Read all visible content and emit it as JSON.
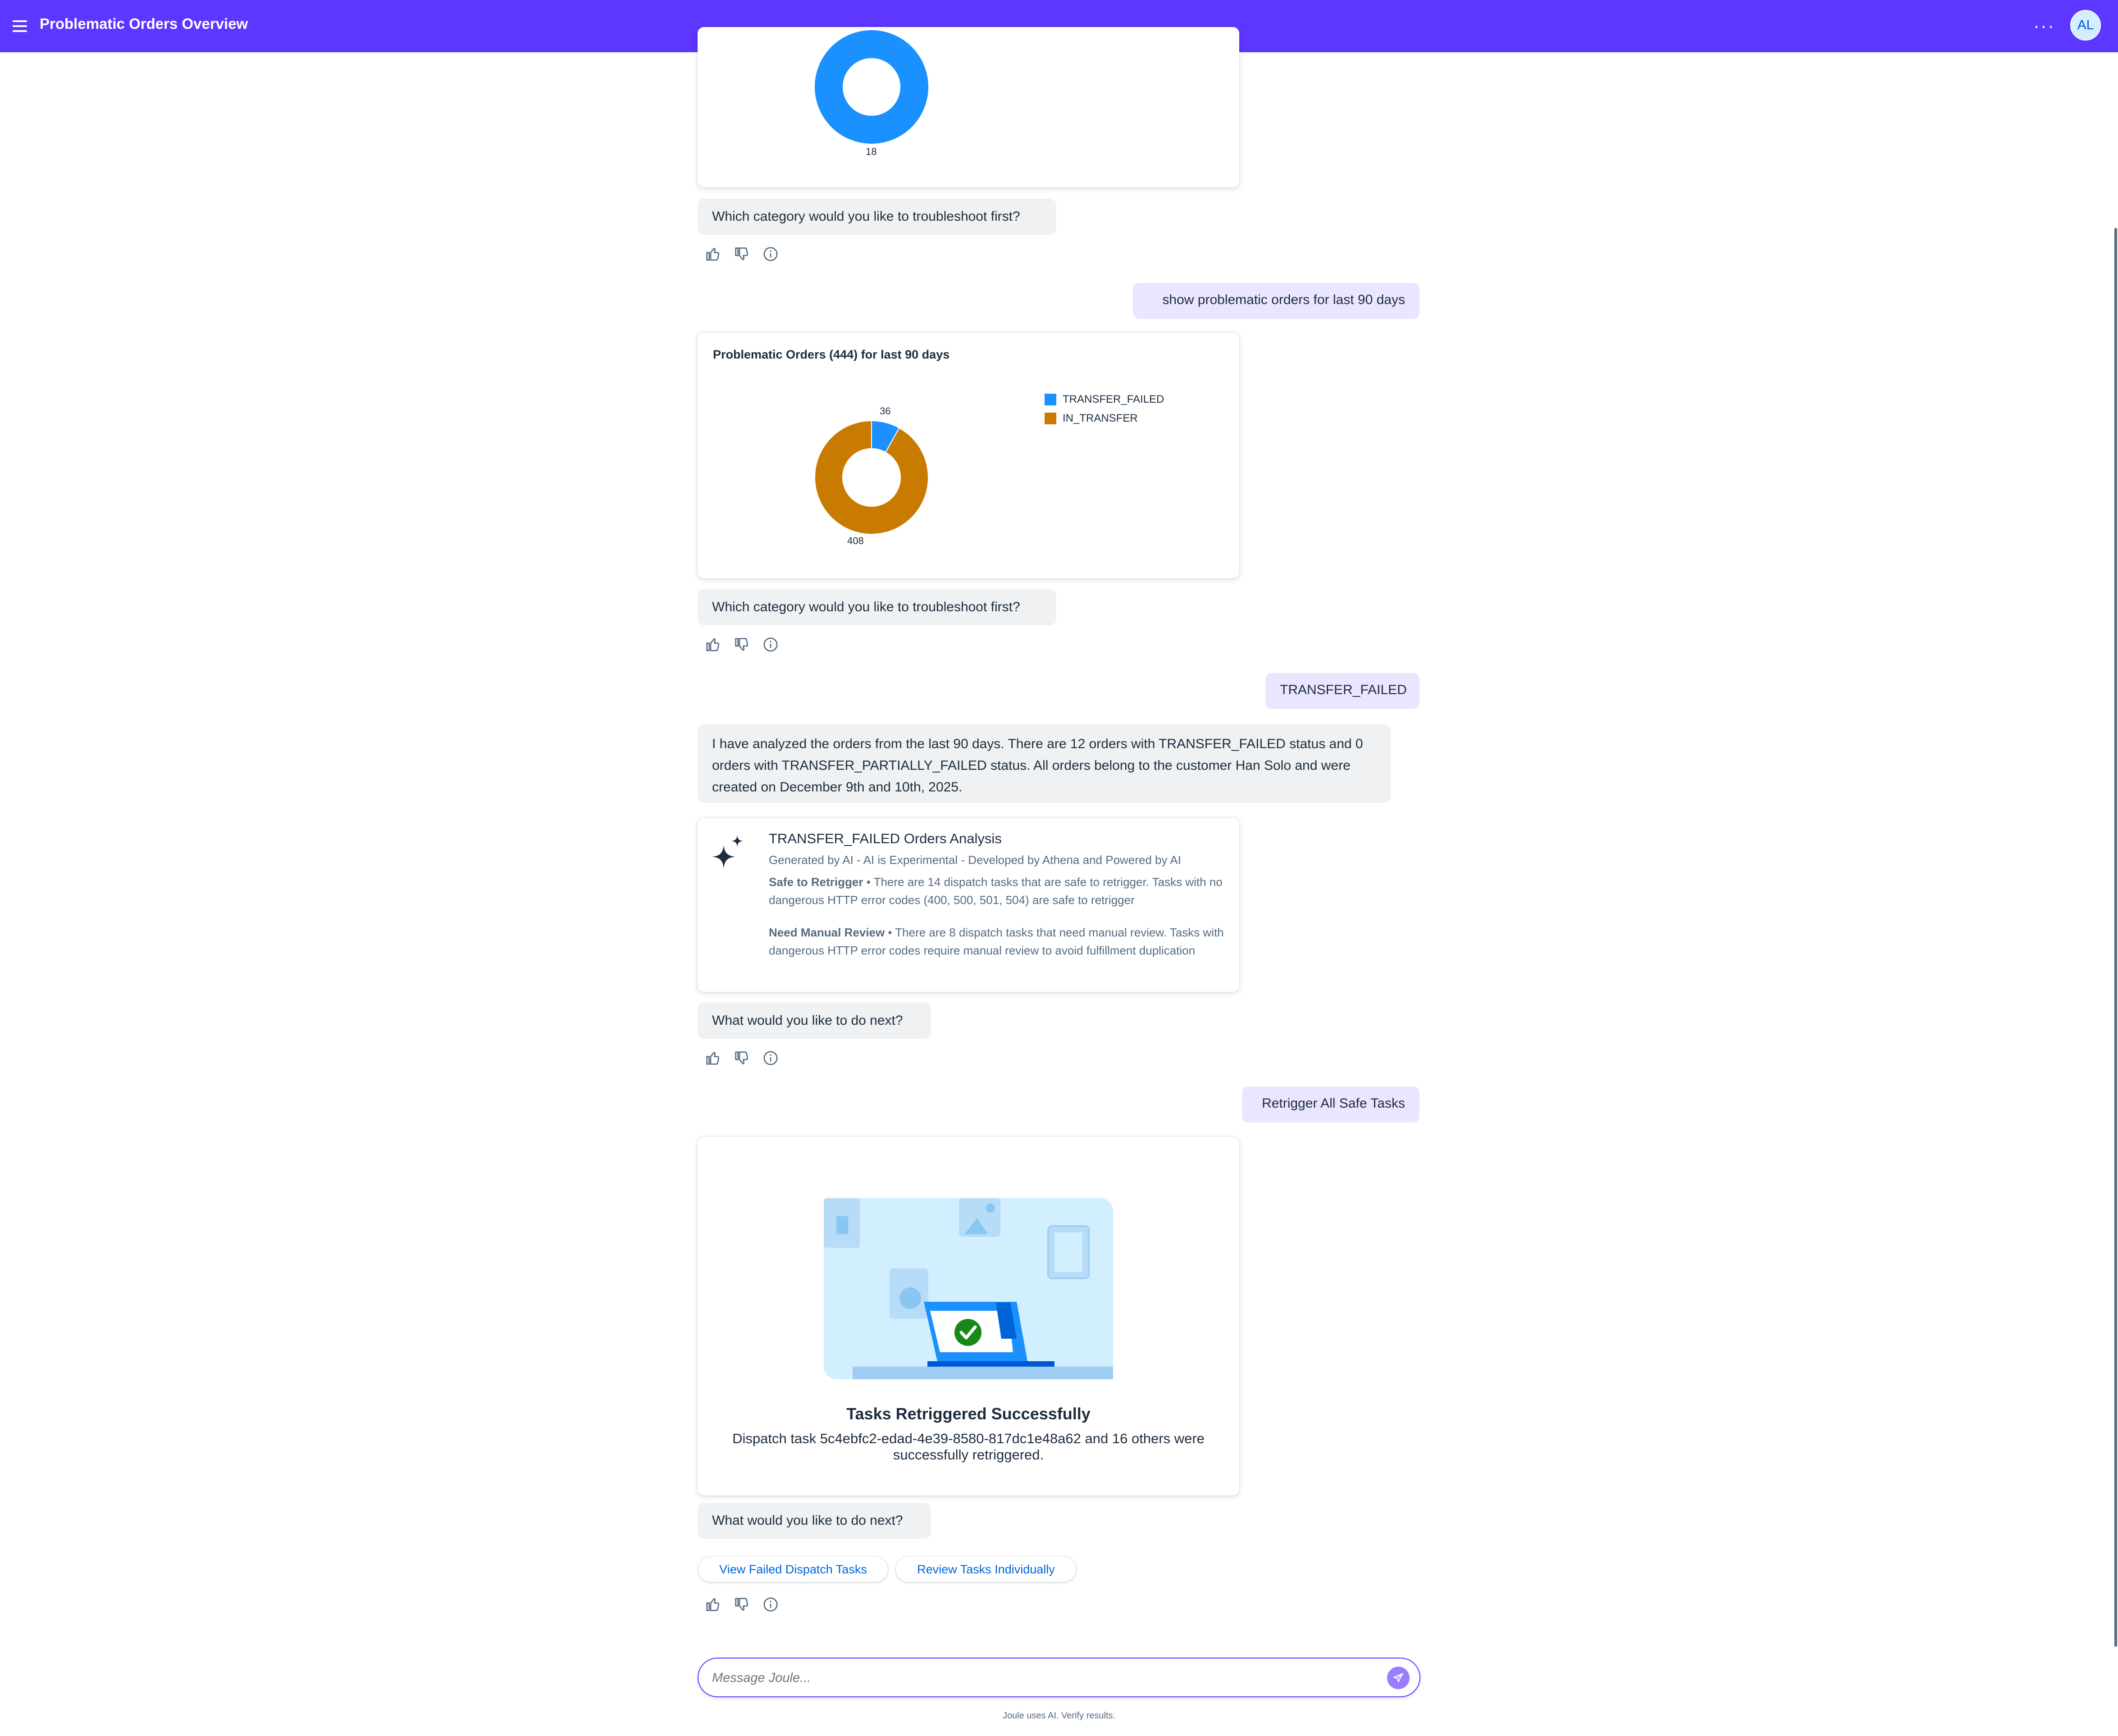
{
  "header": {
    "title": "Problematic Orders Overview",
    "more_icon": "more-horizontal-icon",
    "avatar_initials": "AL",
    "color": "#5d36ff"
  },
  "conversation": {
    "first_chart": {
      "bottom_label": "18",
      "color": "#1b90ff"
    },
    "msg1": "Which category would you like to troubleshoot first?",
    "user1": "show problematic orders for last 90 days",
    "chart2": {
      "title": "Problematic Orders (444) for last 90 days",
      "label_small": "36",
      "label_large": "408"
    },
    "msg2": "Which category would you like to troubleshoot first?",
    "user2": "TRANSFER_FAILED",
    "analysis_text": "I have analyzed the orders from the last 90 days. There are 12 orders with TRANSFER_FAILED status and 0 orders with TRANSFER_PARTIALLY_FAILED status. All orders belong to the customer Han Solo and were created on December 9th and 10th, 2025.",
    "analysis_card": {
      "title": "TRANSFER_FAILED Orders Analysis",
      "subtitle": "Generated by AI - AI is Experimental - Developed by Athena and Powered by AI",
      "safe_heading": "Safe to Retrigger",
      "safe_text": " • There are 14 dispatch tasks that are safe to retrigger. Tasks with no dangerous HTTP error codes (400, 500, 501, 504) are safe to retrigger",
      "review_heading": "Need Manual Review",
      "review_text": " • There are 8 dispatch tasks that need manual review. Tasks with dangerous HTTP error codes require manual review to avoid fulfillment duplication"
    },
    "msg3": "What would you like to do next?",
    "user3": "Retrigger All Safe Tasks",
    "success_card": {
      "title": "Tasks Retriggered Successfully",
      "text": "Dispatch task 5c4ebfc2-edad-4e39-8580-817dc1e48a62 and 16 others were successfully retriggered."
    },
    "msg4": "What would you like to do next?",
    "actions": [
      "View Failed Dispatch Tasks",
      "Review Tasks Individually"
    ]
  },
  "composer": {
    "placeholder": "Message Joule...",
    "disclaimer": "Joule uses AI. Verify results."
  },
  "chart_data": [
    {
      "type": "pie",
      "style": "donut",
      "slices": [
        {
          "label": "",
          "value": 18,
          "color": "#1b90ff"
        }
      ]
    },
    {
      "type": "pie",
      "style": "donut",
      "title": "Problematic Orders (444) for last 90 days",
      "legend_position": "right",
      "slices": [
        {
          "label": "TRANSFER_FAILED",
          "value": 36,
          "color": "#1b90ff"
        },
        {
          "label": "IN_TRANSFER",
          "value": 408,
          "color": "#c87b00"
        }
      ]
    }
  ]
}
